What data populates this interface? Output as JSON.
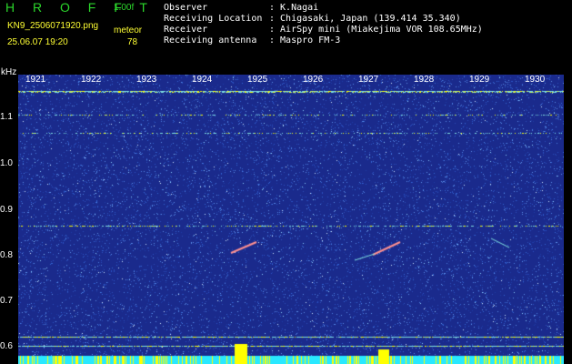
{
  "header": {
    "app_title": "H R O F F T",
    "version": "1.00f",
    "filename": "KN9_2506071920.png",
    "meteor_label": "meteor",
    "datetime": "25.06.07 19:20",
    "meteor_count": "78"
  },
  "info": [
    {
      "key": "Observer",
      "value": ": K.Nagai"
    },
    {
      "key": "Receiving Location",
      "value": ": Chigasaki, Japan (139.414 35.340)"
    },
    {
      "key": "Receiver",
      "value": ": AirSpy mini (Miakejima VOR 108.65MHz)"
    },
    {
      "key": "Receiving antenna",
      "value": ": Maspro FM-3"
    }
  ],
  "axis": {
    "unit": "kHz",
    "y_ticks": [
      "1.1",
      "1.0",
      "0.9",
      "0.8",
      "0.7",
      "0.6"
    ],
    "x_ticks": [
      "1921",
      "1922",
      "1923",
      "1924",
      "1925",
      "1926",
      "1927",
      "1928",
      "1929",
      "1930"
    ]
  },
  "colors": {
    "background": "#1a2a8c",
    "noise_light": "#2e6fd0",
    "signal": "#7ee0e0",
    "bright": "#ffff00",
    "header_green": "#2bd62b",
    "header_yellow": "#ffff33"
  }
}
